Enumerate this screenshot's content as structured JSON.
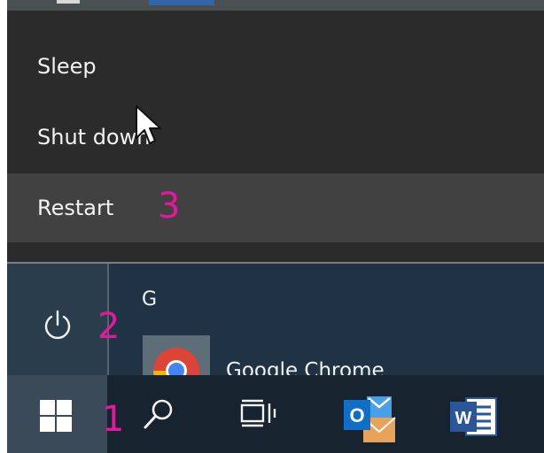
{
  "power_menu": {
    "items": [
      {
        "label": "Sleep"
      },
      {
        "label": "Shut down"
      },
      {
        "label": "Restart"
      }
    ],
    "highlighted": "Restart"
  },
  "annotations": {
    "step1": "1",
    "step2": "2",
    "step3": "3",
    "color": "#e5189b"
  },
  "start_menu": {
    "group_letter": "G",
    "app_label": "Google Chrome"
  },
  "taskbar": {
    "icons": [
      "windows-start-icon",
      "search-icon",
      "task-view-icon",
      "outlook-icon",
      "word-icon"
    ]
  },
  "colors": {
    "menu_bg": "#2b2b2b",
    "menu_highlight": "#414141",
    "start_bg": "#1f3344",
    "taskbar_bg": "#17232e",
    "outlook_blue": "#0f6fc6",
    "word_blue": "#2b579a"
  }
}
